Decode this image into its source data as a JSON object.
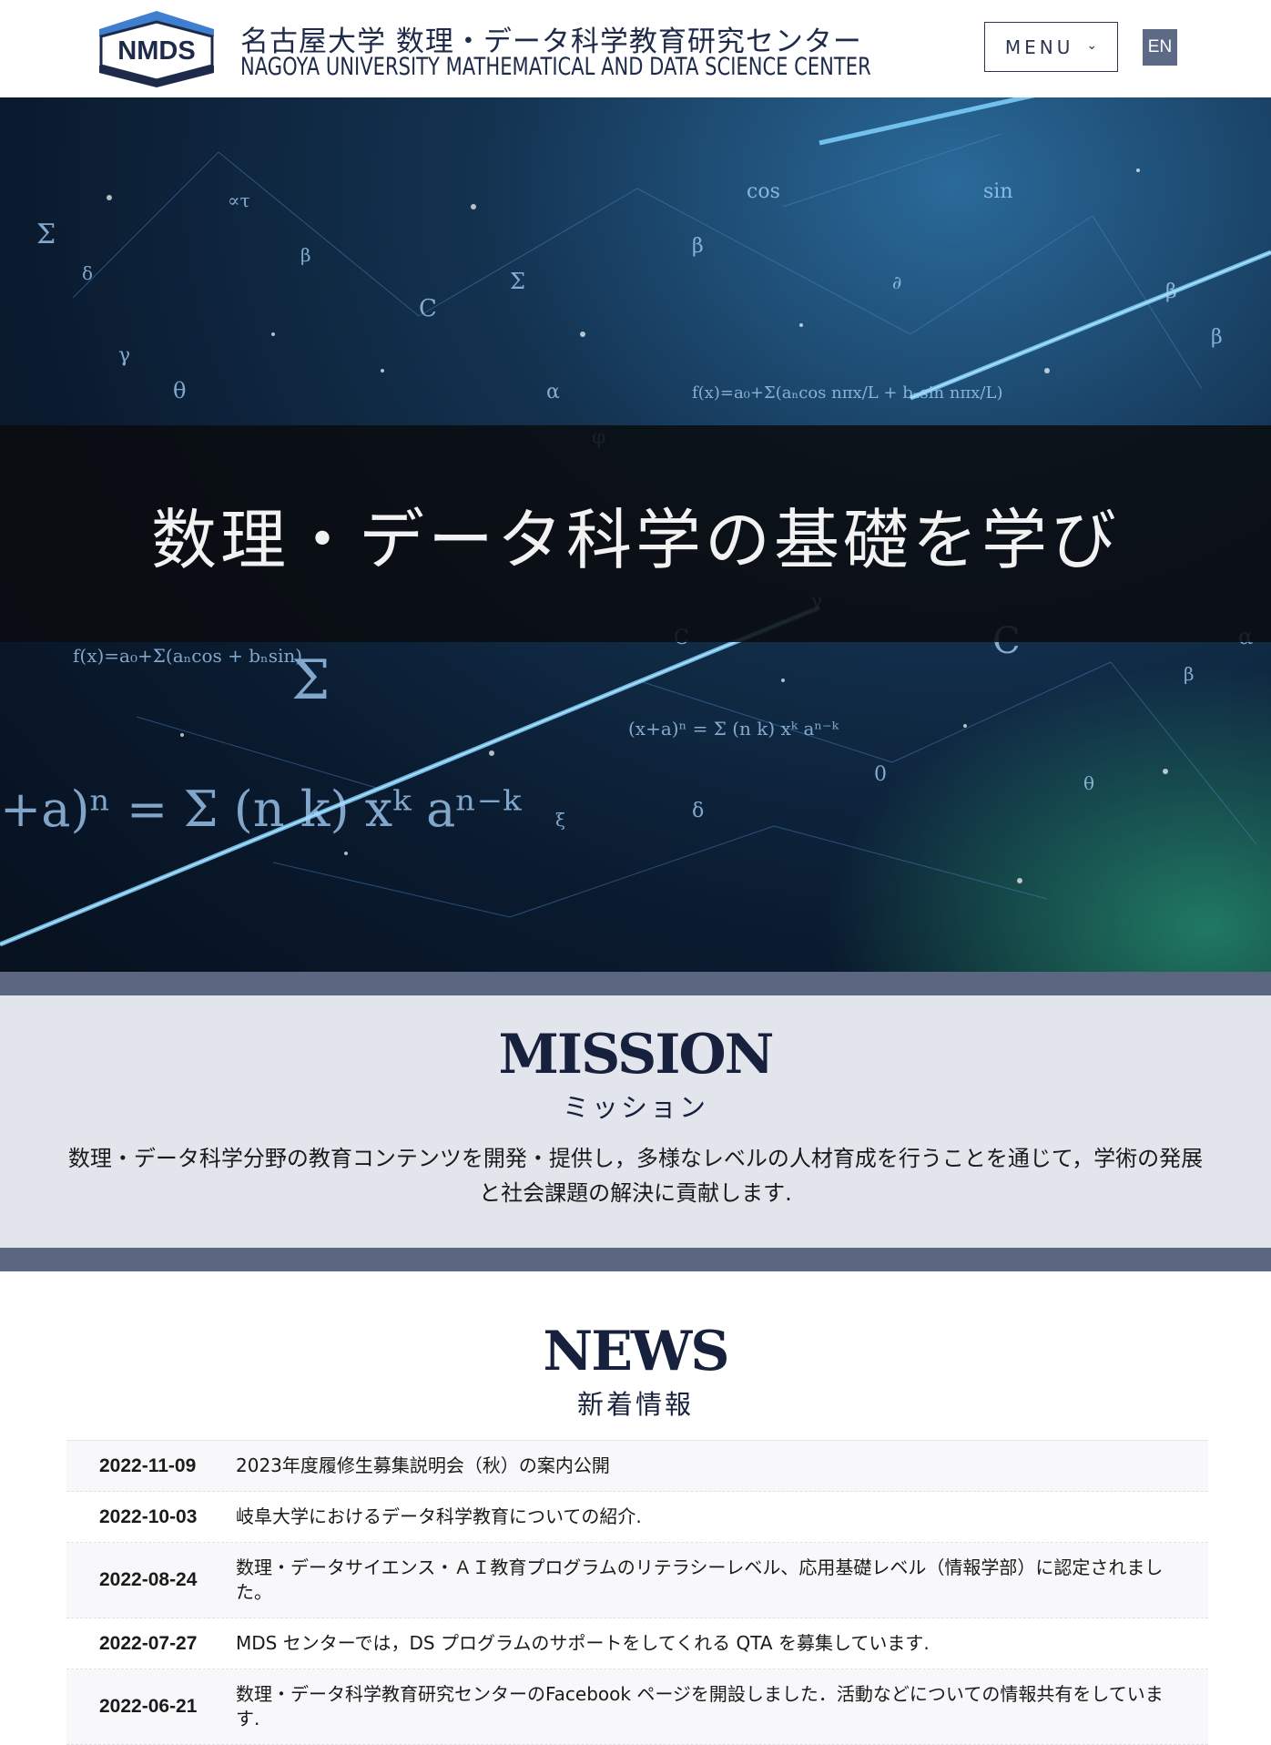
{
  "header": {
    "logo_text": "NMDS",
    "title_ja": "名古屋大学 数理・データ科学教育研究センター",
    "title_en": "NAGOYA UNIVERSITY MATHEMATICAL AND DATA SCIENCE CENTER",
    "menu_label": "MENU",
    "lang_label": "EN"
  },
  "hero": {
    "heading": "数理・データ科学の基礎を学び"
  },
  "mission": {
    "title": "MISSION",
    "subtitle": "ミッション",
    "text": "数理・データ科学分野の教育コンテンツを開発・提供し，多様なレベルの人材育成を行うことを通じて，学術の発展と社会課題の解決に貢献します."
  },
  "news": {
    "title": "NEWS",
    "subtitle": "新着情報",
    "items": [
      {
        "date": "2022-11-09",
        "title": "2023年度履修生募集説明会（秋）の案内公開"
      },
      {
        "date": "2022-10-03",
        "title": "岐阜大学におけるデータ科学教育についての紹介."
      },
      {
        "date": "2022-08-24",
        "title": "数理・データサイエンス・ＡＩ教育プログラムのリテラシーレベル、応用基礎レベル（情報学部）に認定されました。"
      },
      {
        "date": "2022-07-27",
        "title": "MDS センターでは，DS プログラムのサポートをしてくれる QTA を募集しています."
      },
      {
        "date": "2022-06-21",
        "title": "数理・データ科学教育研究センターのFacebook ページを開設しました．活動などについての情報共有をしています."
      }
    ]
  },
  "colors": {
    "navy": "#17213d",
    "strip": "#5b6681",
    "mission_bg": "#e3e5ec"
  }
}
